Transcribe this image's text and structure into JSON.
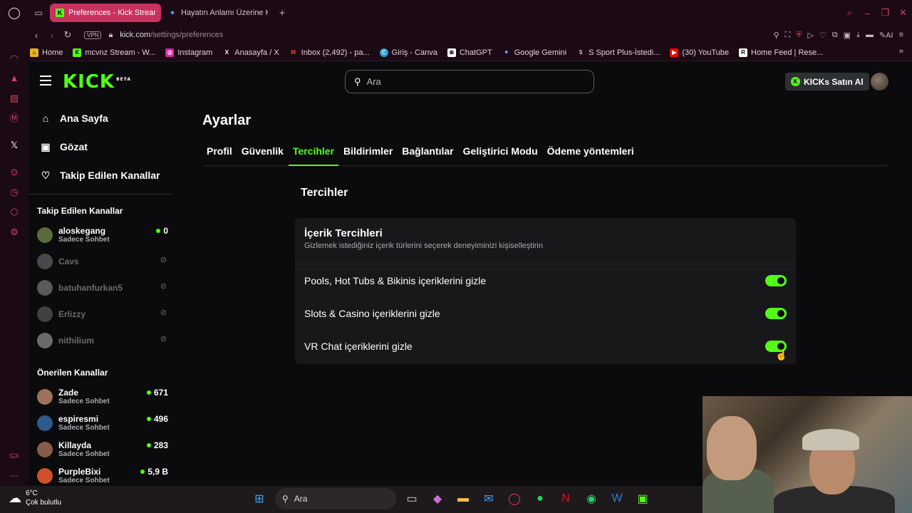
{
  "browser": {
    "tabs": [
      {
        "title": "Preferences - Kick Stream",
        "active": true
      },
      {
        "title": "Hayatın Anlamı Üzerine Ko",
        "active": false
      }
    ],
    "url_host": "kick.com",
    "url_path": "/settings/preferences",
    "vpn_label": "VPN",
    "ai_label": "AI",
    "bookmarks": [
      {
        "label": "Home",
        "icon": "home-icon"
      },
      {
        "label": "mcvnz Stream - W...",
        "icon": "kick-icon"
      },
      {
        "label": "Instagram",
        "icon": "instagram-icon"
      },
      {
        "label": "Anasayfa / X",
        "icon": "x-icon"
      },
      {
        "label": "Inbox (2,492) - pa...",
        "icon": "gmail-icon"
      },
      {
        "label": "Giriş - Canva",
        "icon": "canva-icon"
      },
      {
        "label": "ChatGPT",
        "icon": "chatgpt-icon"
      },
      {
        "label": "Google Gemini",
        "icon": "gemini-icon"
      },
      {
        "label": "S Sport Plus-İstedi...",
        "icon": "ssport-icon"
      },
      {
        "label": "(30) YouTube",
        "icon": "youtube-icon"
      },
      {
        "label": "Home Feed | Rese...",
        "icon": "rg-icon"
      }
    ]
  },
  "kick": {
    "logo": "KICK",
    "logo_badge": "BETA",
    "search_placeholder": "Ara",
    "buy_kicks": "KICKs Satın Al",
    "nav": [
      {
        "label": "Ana Sayfa",
        "icon": "home-icon"
      },
      {
        "label": "Gözat",
        "icon": "browse-icon"
      },
      {
        "label": "Takip Edilen Kanallar",
        "icon": "heart-icon"
      }
    ],
    "followed_title": "Takip Edilen Kanallar",
    "followed": [
      {
        "name": "aloskegang",
        "sub": "Sadece Sohbet",
        "viewers": "0",
        "live": true
      },
      {
        "name": "Cavs",
        "live": false
      },
      {
        "name": "batuhanfurkan5",
        "live": false
      },
      {
        "name": "Erlizzy",
        "live": false
      },
      {
        "name": "nithilium",
        "live": false
      }
    ],
    "recommended_title": "Önerilen Kanallar",
    "recommended": [
      {
        "name": "Zade",
        "sub": "Sadece Sohbet",
        "viewers": "671"
      },
      {
        "name": "espiresmi",
        "sub": "Sadece Sohbet",
        "viewers": "496"
      },
      {
        "name": "Killayda",
        "sub": "Sadece Sohbet",
        "viewers": "283"
      },
      {
        "name": "PurpleBixi",
        "sub": "Sadece Sohbet",
        "viewers": "5,9 B"
      }
    ]
  },
  "settings": {
    "title": "Ayarlar",
    "tabs": [
      "Profil",
      "Güvenlik",
      "Tercihler",
      "Bildirimler",
      "Bağlantılar",
      "Geliştirici Modu",
      "Ödeme yöntemleri"
    ],
    "active_tab": "Tercihler",
    "section_title": "Tercihler",
    "card_title": "İçerik Tercihleri",
    "card_desc": "Gizlemek istediğiniz içerik türlerini seçerek deneyiminizi kişiselleştirin",
    "options": [
      {
        "label": "Pools, Hot Tubs & Bikinis içeriklerini gizle",
        "enabled": true
      },
      {
        "label": "Slots & Casino içeriklerini gizle",
        "enabled": true
      },
      {
        "label": "VR Chat içeriklerini gizle",
        "enabled": true
      }
    ]
  },
  "taskbar": {
    "temperature": "6°C",
    "weather": "Çok bulutlu",
    "search": "Ara"
  },
  "colors": {
    "accent": "#53fc18",
    "active_tab_bg": "#c8325f",
    "opera_red": "#d3405f"
  }
}
